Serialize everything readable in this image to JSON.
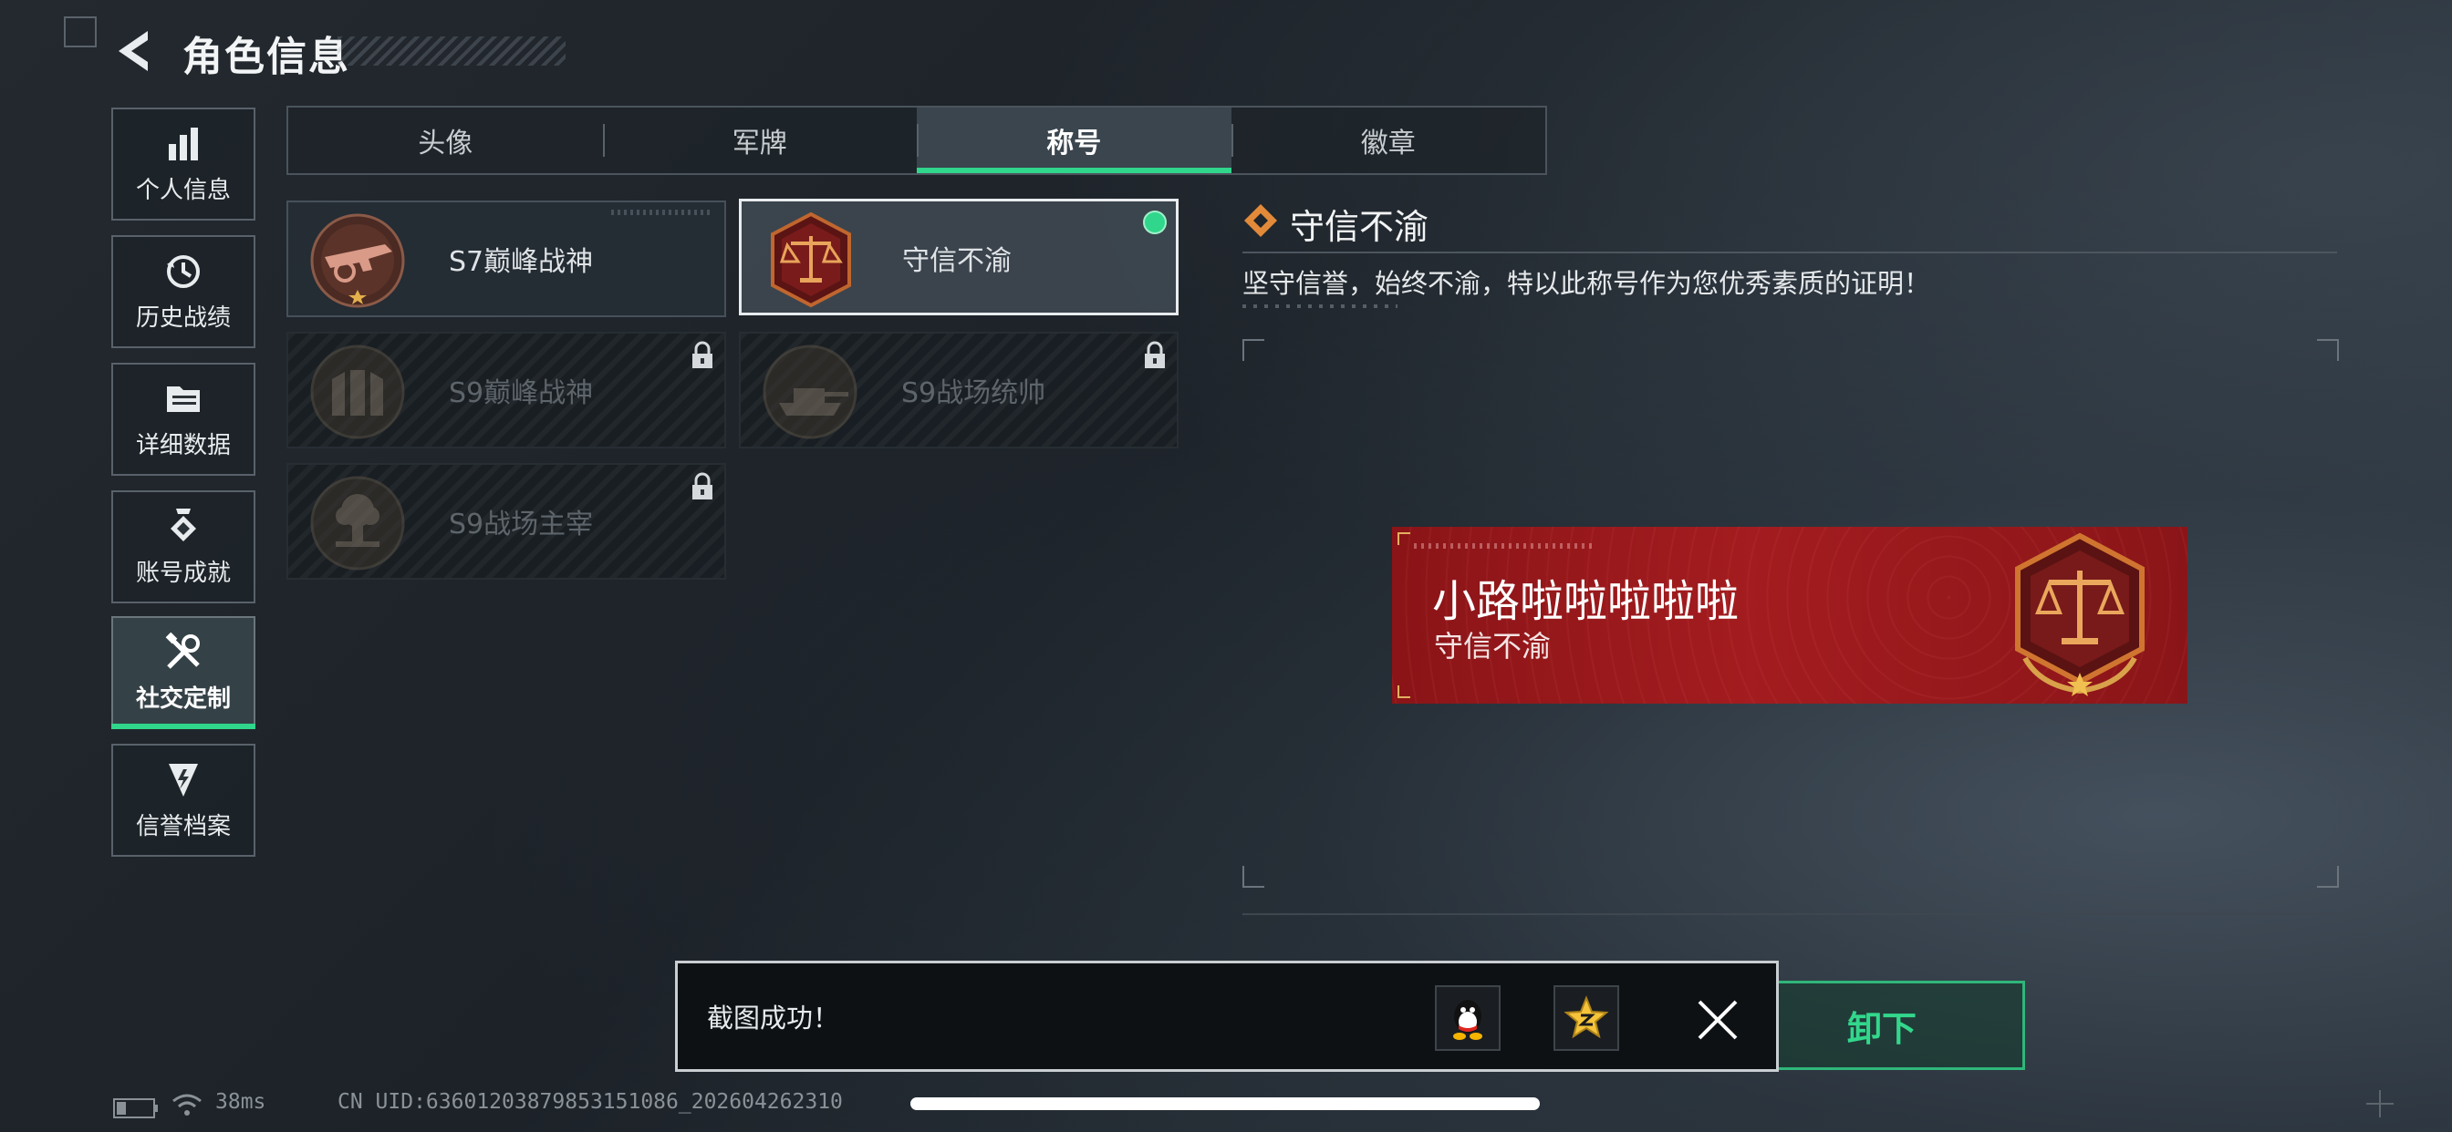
{
  "header": {
    "title": "角色信息"
  },
  "nav": {
    "items": [
      {
        "label": "个人信息",
        "icon": "bar-chart-icon",
        "active": false
      },
      {
        "label": "历史战绩",
        "icon": "history-icon",
        "active": false
      },
      {
        "label": "详细数据",
        "icon": "folder-icon",
        "active": false
      },
      {
        "label": "账号成就",
        "icon": "achievement-icon",
        "active": false
      },
      {
        "label": "社交定制",
        "icon": "tools-icon",
        "active": true
      },
      {
        "label": "信誉档案",
        "icon": "reputation-icon",
        "active": false
      }
    ]
  },
  "tabs": [
    {
      "label": "头像",
      "active": false
    },
    {
      "label": "军牌",
      "active": false
    },
    {
      "label": "称号",
      "active": true
    },
    {
      "label": "徽章",
      "active": false
    }
  ],
  "titles": [
    {
      "name": "S7巅峰战神",
      "state": "owned",
      "emblem": "rifle-emblem-icon"
    },
    {
      "name": "守信不渝",
      "state": "selected",
      "emblem": "scales-emblem-icon"
    },
    {
      "name": "S9巅峰战神",
      "state": "locked",
      "emblem": "fortress-emblem-icon"
    },
    {
      "name": "S9战场统帅",
      "state": "locked",
      "emblem": "tank-emblem-icon"
    },
    {
      "name": "S9战场主宰",
      "state": "locked",
      "emblem": "explosion-emblem-icon"
    }
  ],
  "detail": {
    "title": "守信不渝",
    "description": "坚守信誉，始终不渝，特以此称号作为您优秀素质的证明！"
  },
  "banner": {
    "player_name": "小路啦啦啦啦啦",
    "title": "守信不渝",
    "emblem": "scales-emblem-icon"
  },
  "unload_button": {
    "label": "卸下"
  },
  "toast": {
    "message": "截图成功！",
    "share_icons": [
      "qq-icon",
      "qzone-icon"
    ],
    "close_icon": "close-icon"
  },
  "status": {
    "latency": "38ms",
    "uid": "CN UID:6360120387985315108​6_202604262310"
  },
  "colors": {
    "accent": "#30d68b",
    "banner_red": "#a31c1f",
    "detail_orange": "#e38a3a"
  }
}
